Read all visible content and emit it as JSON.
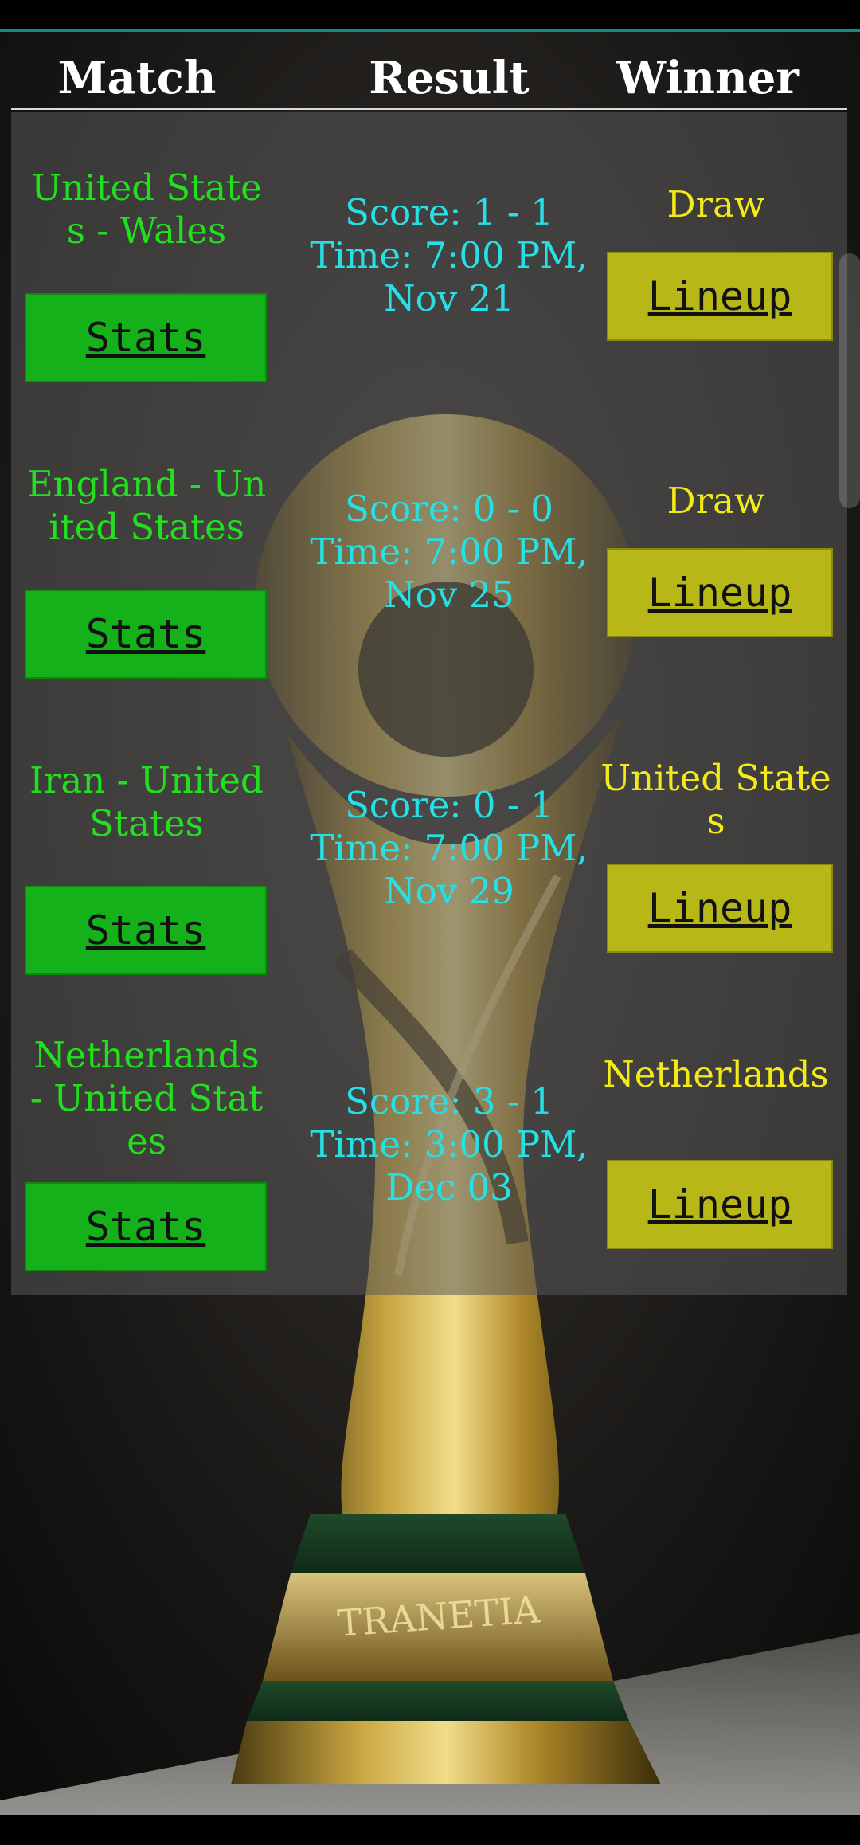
{
  "header": {
    "match": "Match",
    "result": "Result",
    "winner": "Winner"
  },
  "buttons": {
    "stats": "Stats",
    "lineup": "Lineup"
  },
  "matches": [
    {
      "match": "United States - Wales",
      "score": "Score: 1 - 1",
      "time": "Time: 7:00 PM, Nov 21",
      "winner": "Draw"
    },
    {
      "match": "England - United States",
      "score": "Score: 0 - 0",
      "time": "Time: 7:00 PM, Nov 25",
      "winner": "Draw"
    },
    {
      "match": "Iran - United States",
      "score": "Score: 0 - 1",
      "time": "Time: 7:00 PM, Nov 29",
      "winner": "United States"
    },
    {
      "match": "Netherlands - United States",
      "score": "Score: 3 - 1",
      "time": "Time: 3:00 PM, Dec 03",
      "winner": "Netherlands"
    }
  ],
  "trophy_engraving": "TRANETIA",
  "colors": {
    "match_text": "#22e01e",
    "result_text": "#26e0e6",
    "winner_text": "#f3ea1a",
    "stats_button": "#15b11b",
    "lineup_button": "#b8b718",
    "accent_line": "#0d8f8a"
  }
}
